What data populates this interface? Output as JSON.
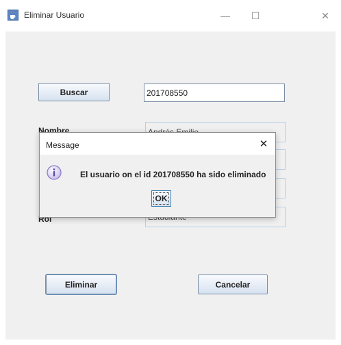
{
  "window": {
    "title": "Eliminar Usuario",
    "icon": "java-cup-icon",
    "controls": {
      "minimize": "—",
      "maximize": "☐",
      "close": "✕"
    }
  },
  "search": {
    "button_label": "Buscar",
    "id_value": "201708550"
  },
  "form": {
    "nombre_label": "Nombre",
    "nombre_value": "Andrés Emilio",
    "rol_label": "Rol",
    "rol_value": "Estudiante"
  },
  "actions": {
    "eliminar_label": "Eliminar",
    "cancelar_label": "Cancelar"
  },
  "dialog": {
    "title": "Message",
    "close": "✕",
    "icon": "info-icon",
    "message": "El usuario on el id 201708550 ha sido eliminado",
    "ok_label": "OK"
  },
  "colors": {
    "client_bg": "#f0f0f0",
    "button_border": "#7a8ea6",
    "info_icon": "#8a78c8"
  }
}
